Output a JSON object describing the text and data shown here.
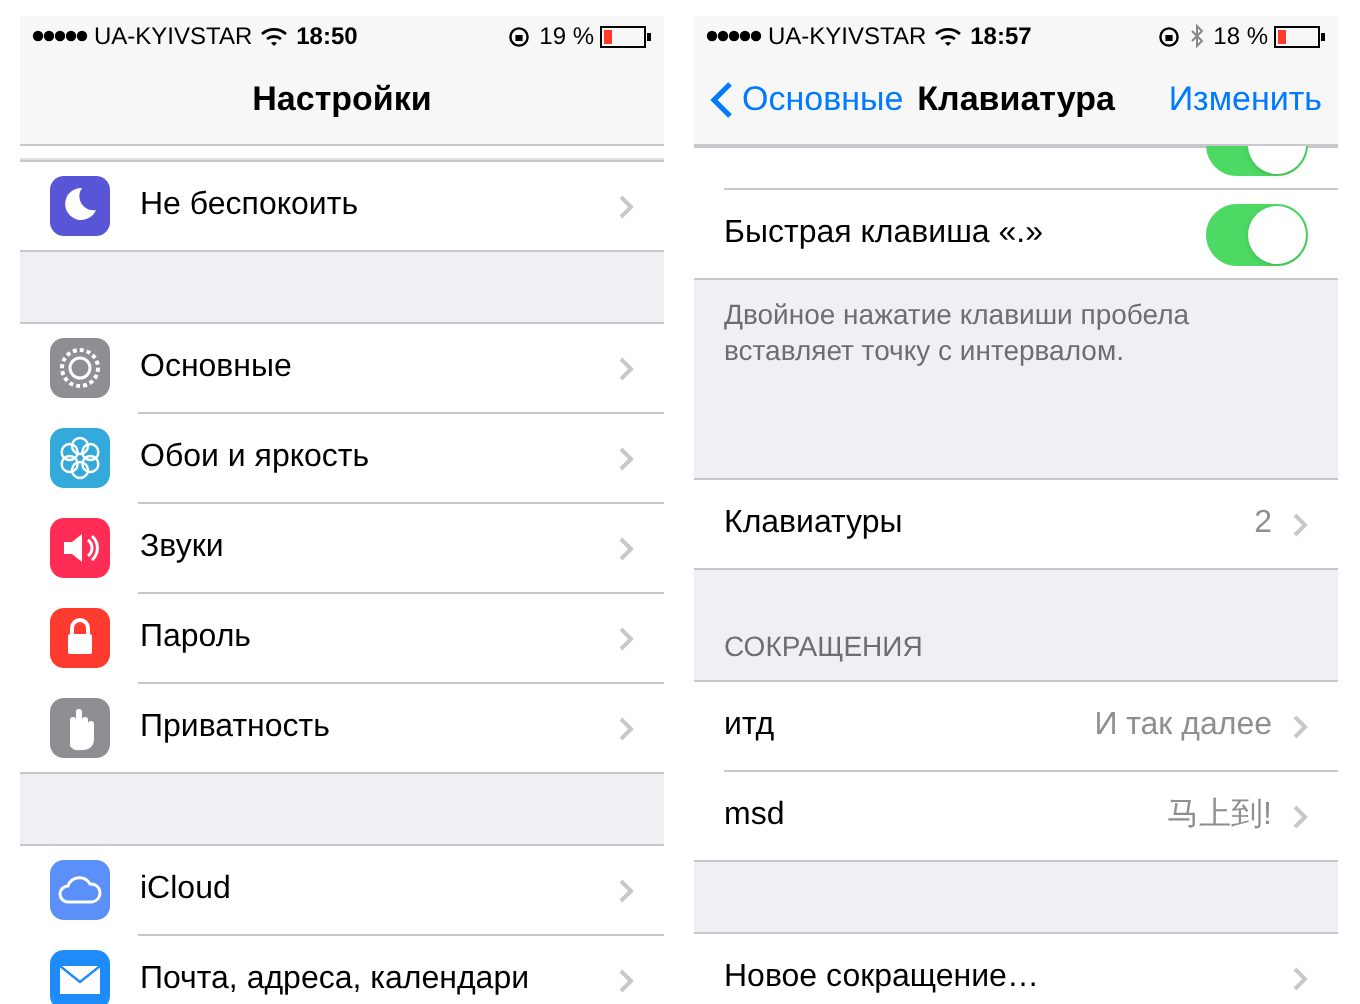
{
  "screens": [
    {
      "status_bar": {
        "carrier": "UA-KYIVSTAR",
        "time": "18:50",
        "battery": "19 %",
        "bluetooth": false
      },
      "nav": {
        "title": "Настройки"
      },
      "sections": [
        {
          "rows": [
            {
              "kind": "link",
              "label": "Не беспокоить",
              "color": "#5856d6"
            }
          ]
        },
        {
          "rows": [
            {
              "kind": "link",
              "label": "Основные",
              "color": "#8e8e93"
            },
            {
              "kind": "link",
              "label": "Обои и яркость",
              "color": "#34aadc"
            },
            {
              "kind": "link",
              "label": "Звуки",
              "color": "#ff2d55"
            },
            {
              "kind": "link",
              "label": "Пароль",
              "color": "#ff3b30"
            },
            {
              "kind": "link",
              "label": "Приватность",
              "color": "#8e8e93"
            }
          ]
        },
        {
          "rows": [
            {
              "kind": "link",
              "label": "iCloud",
              "color": "#5b8ff9"
            },
            {
              "kind": "link",
              "label": "Почта, адреса, календари",
              "color": "#1d8cf8"
            }
          ]
        }
      ]
    },
    {
      "status_bar": {
        "carrier": "UA-KYIVSTAR",
        "time": "18:57",
        "battery": "18 %",
        "bluetooth": true
      },
      "nav": {
        "back": "Основные",
        "title": "Клавиатура",
        "action": "Изменить"
      },
      "sections": [
        {
          "rows": [
            {
              "kind": "toggle",
              "on": true
            },
            {
              "kind": "toggle",
              "label": "Быстрая клавиша «.»",
              "on": true
            }
          ],
          "footer": "Двойное нажатие клавиши пробела вставляет точку с интервалом."
        },
        {
          "rows": [
            {
              "kind": "link",
              "label": "Клавиатуры",
              "value": "2"
            }
          ]
        },
        {
          "header": "СОКРАЩЕНИЯ",
          "rows": [
            {
              "kind": "link",
              "label": "итд",
              "value": "И так далее"
            },
            {
              "kind": "link",
              "label": "msd",
              "value": "马上到!"
            }
          ]
        },
        {
          "rows": [
            {
              "kind": "link",
              "label": "Новое сокращение…"
            }
          ]
        }
      ]
    }
  ]
}
